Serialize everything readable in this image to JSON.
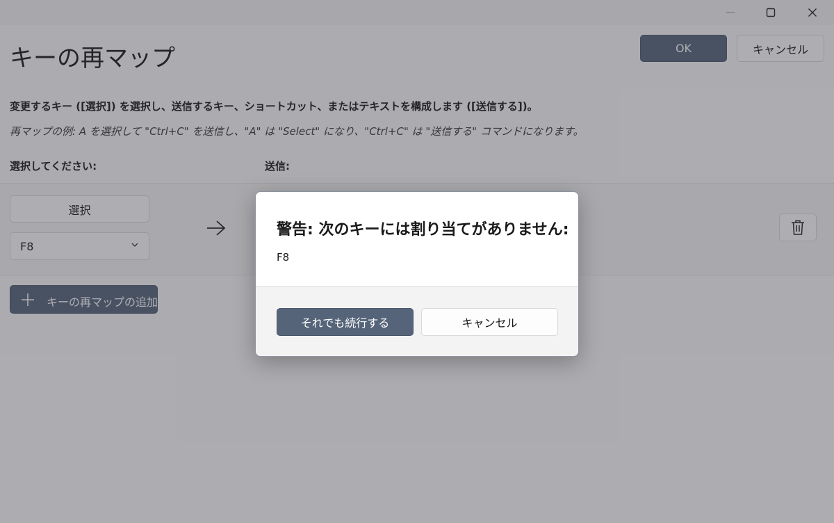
{
  "window": {
    "minimize_glyph": "—",
    "maximize_glyph": "☐",
    "close_glyph": "✕"
  },
  "header": {
    "title": "キーの再マップ",
    "ok_label": "OK",
    "cancel_label": "キャンセル"
  },
  "main": {
    "description": "変更するキー ([選択]) を選択し、送信するキー、ショートカット、またはテキストを構成します ([送信する])。",
    "example": "再マップの例: A を選択して \"Ctrl+C\" を送信し、\"A\" は \"Select\" になり、\"Ctrl+C\" は \"送信する\" コマンドになります。",
    "select_column_label": "選択してください:",
    "send_column_label": "送信:",
    "mapping": {
      "select_button_label": "選択",
      "selected_key": "F8",
      "arrow_icon": "arrow-right-icon",
      "delete_icon": "trash-icon"
    },
    "add_button_label": "キーの再マップの追加"
  },
  "dialog": {
    "title": "警告: 次のキーには割り当てがありません:",
    "body": "F8",
    "continue_label": "それでも続行する",
    "cancel_label": "キャンセル"
  },
  "colors": {
    "accent": "#566479",
    "overlay": "rgba(55,55,65,0.40)"
  }
}
